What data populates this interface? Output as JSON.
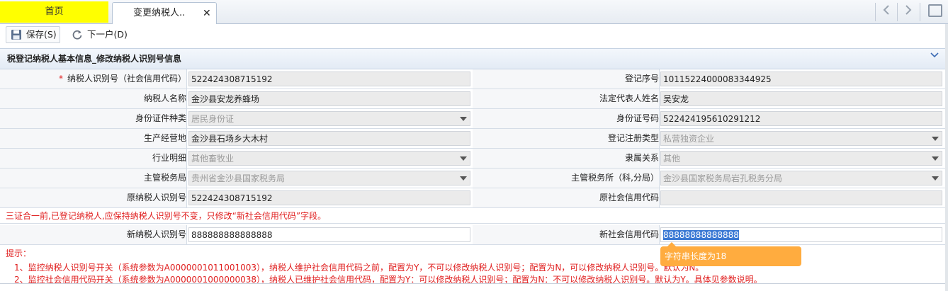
{
  "tabs": {
    "home": "首页",
    "active": "变更纳税人..",
    "close": "✕"
  },
  "toolbar": {
    "save_label": "保存(S)",
    "next_label": "下一户(D)"
  },
  "section": {
    "title": "税登记纳税人基本信息_修改纳税人识别号信息"
  },
  "form": {
    "rows": [
      {
        "left_label": "纳税人识别号（社会信用代码）",
        "left_value": "522424308715192",
        "right_label": "登记序号",
        "right_value": "10115224000083344925"
      },
      {
        "left_label": "纳税人名称",
        "left_value": "金沙县安龙养蜂场",
        "right_label": "法定代表人姓名",
        "right_value": "吴安龙"
      },
      {
        "left_label": "身份证件种类",
        "left_value": "居民身份证",
        "right_label": "身份证号码",
        "right_value": "522424195610291212"
      },
      {
        "left_label": "生产经营地",
        "left_value": "金沙县石场乡大木村",
        "right_label": "登记注册类型",
        "right_value": "私营独资企业"
      },
      {
        "left_label": "行业明细",
        "left_value": "其他畜牧业",
        "right_label": "隶属关系",
        "right_value": "其他"
      },
      {
        "left_label": "主管税务局",
        "left_value": "贵州省金沙县国家税务局",
        "right_label": "主管税务所（科,分局）",
        "right_value": "金沙县国家税务局岩孔税务分局"
      },
      {
        "left_label": "原纳税人识别号",
        "left_value": "522424308715192",
        "right_label": "原社会信用代码",
        "right_value": ""
      }
    ],
    "notice": "三证合一前,已登记纳税人,应保持纳税人识别号不变，只修改“新社会信用代码”字段。",
    "new_row": {
      "left_label": "新纳税人识别号",
      "left_value": "888888888888888",
      "right_label": "新社会信用代码",
      "right_value": "88888888888888"
    }
  },
  "tooltip": "字符串长度为18",
  "tips": {
    "header": "提示：",
    "line1": "1、监控纳税人识别号开关（系统参数为A0000001011001003），纳税人维护社会信用代码之前，配置为Y，不可以修改纳税人识别号；配置为N，可以修改纳税人识别号。默认为N。",
    "line2": "2、监控社会信用代码开关（系统参数为A0000001000000038），纳税人已维护社会信用代码，配置为Y：可以修改纳税人识别号；配置为N：不可以修改纳税人识别号。默认为Y。具体见参数说明。"
  },
  "colors": {
    "home_tab": "#ffff00",
    "tooltip": "#ffac3f",
    "notice": "#e02020",
    "selection": "#3b79d4"
  }
}
